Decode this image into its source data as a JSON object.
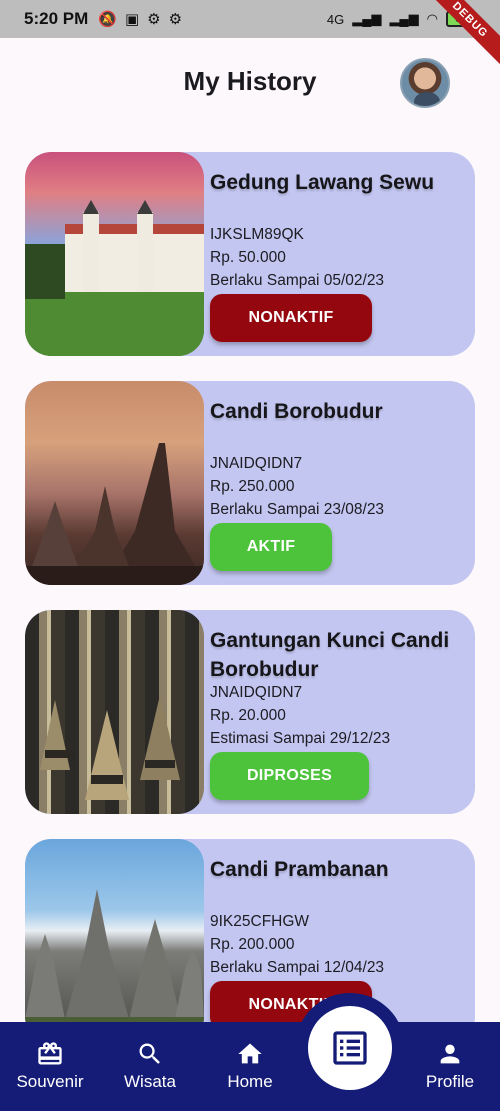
{
  "status_bar": {
    "time": "5:20 PM",
    "network": "4G",
    "battery": "88",
    "debug_label": "DEBUG"
  },
  "header": {
    "title": "My History"
  },
  "history_items": [
    {
      "title": "Gedung Lawang Sewu",
      "code": "IJKSLM89QK",
      "price": "Rp. 50.000",
      "valid": "Berlaku Sampai 05/02/23",
      "status": "NONAKTIF",
      "status_color": "#95070f"
    },
    {
      "title": "Candi Borobudur",
      "code": "JNAIDQIDN7",
      "price": "Rp. 250.000",
      "valid": "Berlaku Sampai 23/08/23",
      "status": "AKTIF",
      "status_color": "#4cc33a"
    },
    {
      "title": "Gantungan Kunci Candi Borobudur",
      "code": "JNAIDQIDN7",
      "price": "Rp. 20.000",
      "valid": "Estimasi Sampai 29/12/23",
      "status": "DIPROSES",
      "status_color": "#4cc33a"
    },
    {
      "title": "Candi Prambanan",
      "code": "9IK25CFHGW",
      "price": "Rp. 200.000",
      "valid": "Berlaku Sampai 12/04/23",
      "status": "NONAKTIF",
      "status_color": "#95070f"
    }
  ],
  "bottom_nav": {
    "items": [
      {
        "label": "Souvenir",
        "icon": "gift-icon"
      },
      {
        "label": "Wisata",
        "icon": "search-icon"
      },
      {
        "label": "Home",
        "icon": "home-icon"
      },
      {
        "label": "",
        "icon": "history-list-icon"
      },
      {
        "label": "Profile",
        "icon": "person-icon"
      }
    ],
    "background": "#141c77",
    "active": "history-list-icon"
  },
  "colors": {
    "card_background": "#c3c6f0",
    "page_background": "#fdf8fc"
  }
}
